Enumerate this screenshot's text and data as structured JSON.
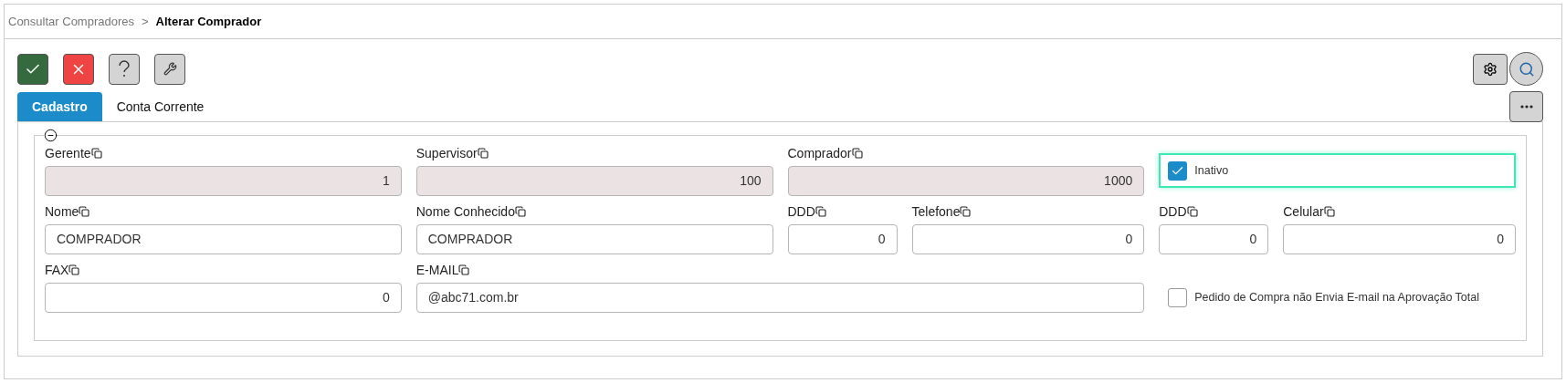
{
  "breadcrumb": {
    "parent": "Consultar Compradores",
    "separator": ">",
    "current": "Alterar Comprador"
  },
  "toolbar": [
    {
      "kind": "confirm"
    },
    {
      "kind": "cancel"
    },
    {
      "kind": "help"
    },
    {
      "kind": "tools"
    }
  ],
  "tabs": [
    {
      "label": "Cadastro",
      "selected": true
    },
    {
      "label": "Conta Corrente",
      "selected": false
    }
  ],
  "rows": [
    [
      {
        "kind": "field",
        "label": "Gerente",
        "value": "1",
        "numeric": true,
        "readonly": true
      },
      {
        "kind": "field",
        "label": "Supervisor",
        "value": "100",
        "numeric": true,
        "readonly": true
      },
      {
        "kind": "field",
        "label": "Comprador",
        "value": "1000",
        "numeric": true,
        "readonly": true
      },
      {
        "kind": "checkbox",
        "label": "Inativo",
        "checked": true,
        "focused": true
      }
    ],
    [
      {
        "kind": "field",
        "label": "Nome",
        "value": "COMPRADOR",
        "numeric": false,
        "readonly": false
      },
      {
        "kind": "field",
        "label": "Nome Conhecido",
        "value": "COMPRADOR",
        "numeric": false,
        "readonly": false
      },
      {
        "kind": "pair",
        "fields": [
          {
            "label": "DDD",
            "value": "0",
            "numeric": true,
            "readonly": false
          },
          {
            "label": "Telefone",
            "value": "0",
            "numeric": true,
            "readonly": false
          }
        ]
      },
      {
        "kind": "pair",
        "fields": [
          {
            "label": "DDD",
            "value": "0",
            "numeric": true,
            "readonly": false
          },
          {
            "label": "Celular",
            "value": "0",
            "numeric": true,
            "readonly": false
          }
        ]
      }
    ],
    [
      {
        "kind": "field",
        "label": "FAX",
        "value": "0",
        "numeric": true,
        "readonly": false
      },
      {
        "kind": "field",
        "label": "E-MAIL",
        "value": "@abc71.com.br",
        "numeric": false,
        "readonly": false,
        "wide": true
      },
      {
        "kind": "checkbox",
        "label": "Pedido de Compra não Envia E-mail na Aprovação Total",
        "checked": false,
        "focused": false
      }
    ]
  ]
}
